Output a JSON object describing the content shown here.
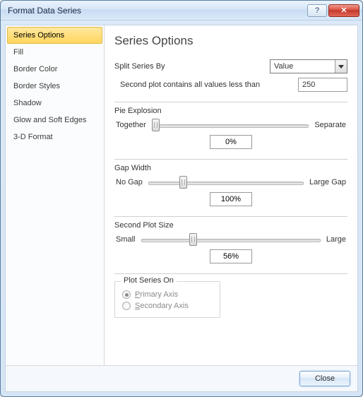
{
  "window": {
    "title": "Format Data Series",
    "close_btn": "✕",
    "help_btn": "?"
  },
  "sidebar": {
    "items": [
      "Series Options",
      "Fill",
      "Border Color",
      "Border Styles",
      "Shadow",
      "Glow and Soft Edges",
      "3-D Format"
    ],
    "selected_index": 0
  },
  "content": {
    "title": "Series Options",
    "split": {
      "label": "Split Series By",
      "value": "Value",
      "second_label": "Second plot contains all values less than",
      "second_value": "250"
    },
    "pie_explosion": {
      "title": "Pie Explosion",
      "min_label": "Together",
      "max_label": "Separate",
      "value": "0%",
      "pos_percent": 0
    },
    "gap_width": {
      "title": "Gap Width",
      "min_label": "No Gap",
      "max_label": "Large Gap",
      "value": "100%",
      "pos_percent": 20
    },
    "second_plot_size": {
      "title": "Second Plot Size",
      "min_label": "Small",
      "max_label": "Large",
      "value": "56%",
      "pos_percent": 27
    },
    "plot_series_on": {
      "title": "Plot Series On",
      "primary": "Primary Axis",
      "secondary": "Secondary Axis",
      "selected": "primary",
      "disabled": true
    }
  },
  "footer": {
    "close": "Close"
  }
}
